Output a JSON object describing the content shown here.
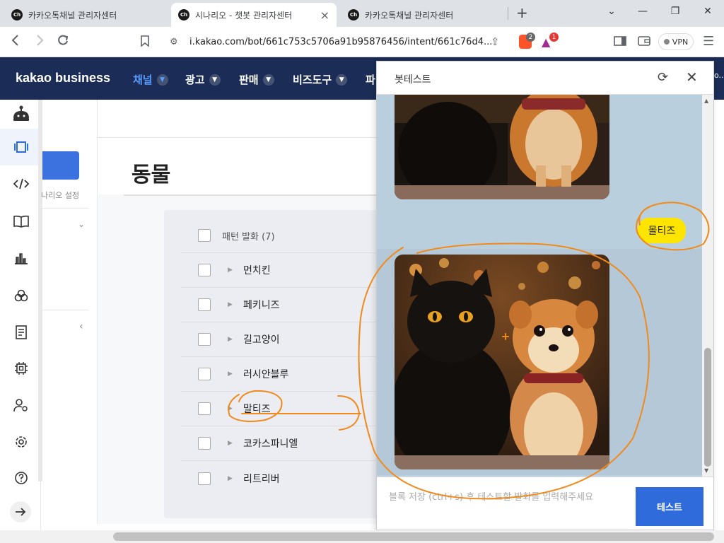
{
  "browser": {
    "tabs": [
      {
        "label": "카카오톡채널 관리자센터",
        "active": false
      },
      {
        "label": "시나리오 - 챗봇 관리자센터",
        "active": true
      },
      {
        "label": "카카오톡채널 관리자센터",
        "active": false
      }
    ],
    "favicon_text": "Ch",
    "url": "i.kakao.com/bot/661c753c5706a91b95876456/intent/661c76d4...",
    "vpn_label": "VPN",
    "brave_badge": "2",
    "rewards_badge": "1"
  },
  "kakao_header": {
    "logo": "kakao business",
    "nav": [
      "채널",
      "광고",
      "판매",
      "비즈도구",
      "파"
    ],
    "clipped_right": "o..."
  },
  "sidebar": {
    "icons": [
      "bot-icon",
      "scenario-icon",
      "code-icon",
      "book-icon",
      "chart-icon",
      "palette-icon",
      "document-icon",
      "chip-icon",
      "user-settings-icon",
      "gear-icon",
      "help-icon",
      "expand-arrow-icon"
    ]
  },
  "sub_panel": {
    "scenario_setting": "나리오 설정"
  },
  "main": {
    "title": "동물",
    "list_header": "패턴 발화 (7)",
    "items": [
      "먼치킨",
      "페키니즈",
      "길고양이",
      "러시안블루",
      "말티즈",
      "코카스파니엘",
      "리트리버"
    ]
  },
  "chat": {
    "title": "봇테스트",
    "user_message": "몰티즈",
    "input_placeholder": "블록 저장 (ctrl+s) 후 테스트할 발화를 입력해주세요",
    "test_button": "테스트"
  },
  "colors": {
    "header_bg": "#1b2d56",
    "accent_blue": "#2f6bdb",
    "user_bubble": "#fee500",
    "chat_bg": "#b9cfdd",
    "annotation": "#f08a1c"
  }
}
